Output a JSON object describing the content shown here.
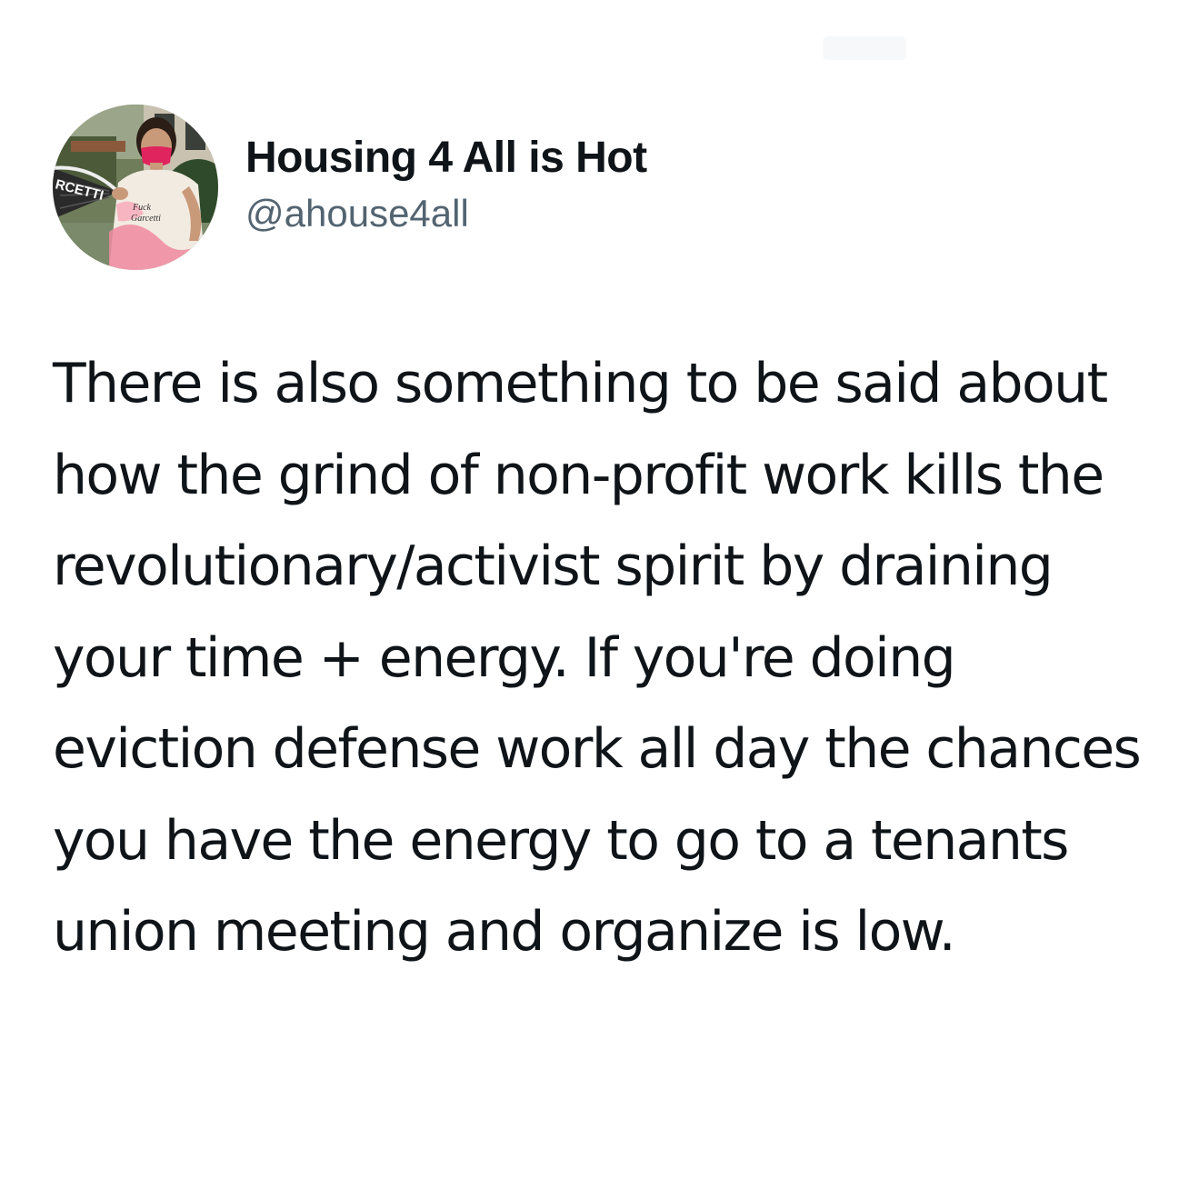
{
  "tweet": {
    "display_name": "Housing 4 All is Hot",
    "handle": "@ahouse4all",
    "text": "There is also something to be said about how the grind of non-profit work kills the revolutionary/activist spirit by draining your time + energy. If you're doing eviction defense work all day the chances you have the energy to go to a tenants union meeting and organize is low.",
    "avatar": {
      "icon": "profile-photo",
      "fan_text": "RCETTI",
      "shirt_text": "Fuck Garcetti"
    }
  },
  "colors": {
    "name": "#0f1419",
    "handle": "#536471",
    "background": "#ffffff"
  }
}
